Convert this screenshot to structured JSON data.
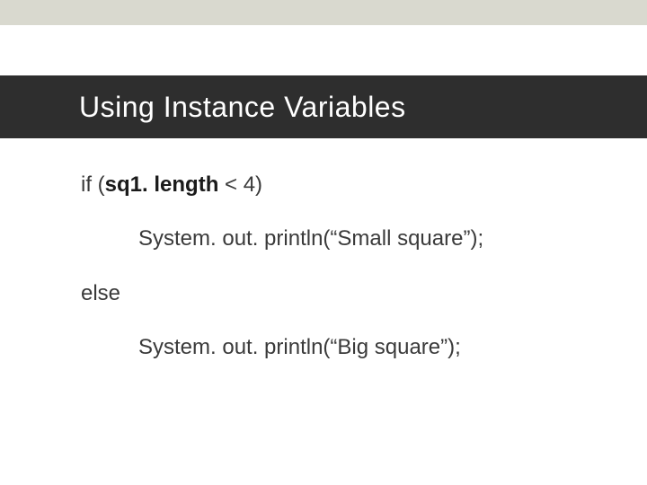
{
  "slide": {
    "title": "Using Instance Variables",
    "code": {
      "line1_prefix": "if (",
      "line1_bold": "sq1. length",
      "line1_suffix": " < 4)",
      "line2": "System. out. println(“Small square”);",
      "line3": "else",
      "line4": "System. out. println(“Big square”);"
    }
  }
}
